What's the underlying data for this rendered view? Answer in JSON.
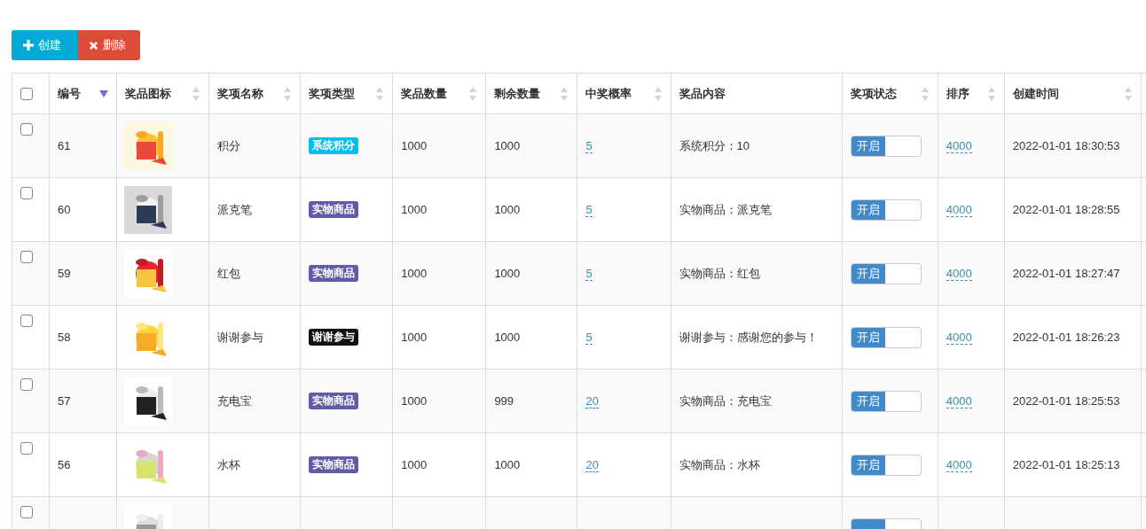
{
  "toolbar": {
    "buttons": [
      {
        "kind": "create",
        "label": "创建"
      },
      {
        "kind": "delete",
        "label": "删除"
      }
    ]
  },
  "table": {
    "select_all": {
      "checked": false
    },
    "columns": [
      {
        "label": "编号",
        "sortable": true,
        "sorted_desc": true
      },
      {
        "label": "奖品图标",
        "sortable": true,
        "sorted_desc": false
      },
      {
        "label": "奖项名称",
        "sortable": true,
        "sorted_desc": false
      },
      {
        "label": "奖项类型",
        "sortable": true,
        "sorted_desc": false
      },
      {
        "label": "奖品数量",
        "sortable": true,
        "sorted_desc": false
      },
      {
        "label": "剩余数量",
        "sortable": true,
        "sorted_desc": false
      },
      {
        "label": "中奖概率",
        "sortable": true,
        "sorted_desc": false
      },
      {
        "label": "奖品内容",
        "sortable": false
      },
      {
        "label": "奖项状态",
        "sortable": true,
        "sorted_desc": false
      },
      {
        "label": "排序",
        "sortable": true,
        "sorted_desc": false
      },
      {
        "label": "创建时间",
        "sortable": true,
        "sorted_desc": false
      }
    ],
    "rows": [
      {
        "checked": false,
        "id": "61",
        "name": "积分",
        "type": {
          "label": "系统积分",
          "color": "#00c0ef"
        },
        "quantity": "1000",
        "remaining": "1000",
        "probability": "5",
        "content": "系统积分：10",
        "status": {
          "label": "开启",
          "on": true
        },
        "order": "4000",
        "created": "2022-01-01 18:30:53"
      },
      {
        "checked": false,
        "id": "60",
        "name": "派克笔",
        "type": {
          "label": "实物商品",
          "color": "#605ca8"
        },
        "quantity": "1000",
        "remaining": "1000",
        "probability": "5",
        "content": "实物商品：派克笔",
        "status": {
          "label": "开启",
          "on": true
        },
        "order": "4000",
        "created": "2022-01-01 18:28:55"
      },
      {
        "checked": false,
        "id": "59",
        "name": "红包",
        "type": {
          "label": "实物商品",
          "color": "#605ca8"
        },
        "quantity": "1000",
        "remaining": "1000",
        "probability": "5",
        "content": "实物商品：红包",
        "status": {
          "label": "开启",
          "on": true
        },
        "order": "4000",
        "created": "2022-01-01 18:27:47"
      },
      {
        "checked": false,
        "id": "58",
        "name": "谢谢参与",
        "type": {
          "label": "谢谢参与",
          "color": "#111111"
        },
        "quantity": "1000",
        "remaining": "1000",
        "probability": "5",
        "content": "谢谢参与：感谢您的参与！",
        "status": {
          "label": "开启",
          "on": true
        },
        "order": "4000",
        "created": "2022-01-01 18:26:23"
      },
      {
        "checked": false,
        "id": "57",
        "name": "充电宝",
        "type": {
          "label": "实物商品",
          "color": "#605ca8"
        },
        "quantity": "1000",
        "remaining": "999",
        "probability": "20",
        "content": "实物商品：充电宝",
        "status": {
          "label": "开启",
          "on": true
        },
        "order": "4000",
        "created": "2022-01-01 18:25:53"
      },
      {
        "checked": false,
        "id": "56",
        "name": "水杯",
        "type": {
          "label": "实物商品",
          "color": "#605ca8"
        },
        "quantity": "1000",
        "remaining": "1000",
        "probability": "20",
        "content": "实物商品：水杯",
        "status": {
          "label": "开启",
          "on": true
        },
        "order": "4000",
        "created": "2022-01-01 18:25:13"
      },
      {
        "checked": false,
        "status": {
          "on": true
        }
      }
    ]
  }
}
